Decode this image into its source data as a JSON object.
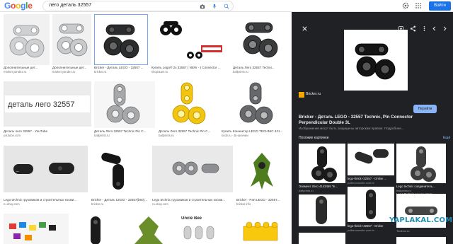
{
  "header": {
    "logo": "Google",
    "query": "лего деталь 32557",
    "signin": "Войти"
  },
  "results": [
    {
      "caption": "Дополнительные дет...",
      "source": "market.yandex.ru"
    },
    {
      "caption": "Дополнительные дет...",
      "source": "market.yandex.ru"
    },
    {
      "caption": "Bricker - Деталь LEGO - 32557 ...",
      "source": "bricker.ru"
    },
    {
      "caption": "Купить Lego® 2x 32557 ( NEW - ) Connector ...",
      "source": "shopotam.ru"
    },
    {
      "caption": "Деталь Лего 32557 Techni...",
      "source": "ballprints.ru"
    },
    {
      "caption": "Деталь лего 32557 - YouTube",
      "source": "youtube.com"
    },
    {
      "caption": "Деталь Лего 32557 Technic Pin C...",
      "source": "ballprints.ru"
    },
    {
      "caption": "Деталь Лего 32557 Technic Pin C...",
      "source": "ballprints.ru"
    },
    {
      "caption": "Купить Коннектор LEGO TECHNIC 421...",
      "source": "svob.ru · В наличии"
    },
    {
      "caption": "Lego technic грузовиков и строительных косми...",
      "source": "ru.ebay.com"
    },
    {
      "caption": "Bricker - Деталь LEGO - 32557(b60)...",
      "source": "bricker.ru"
    },
    {
      "caption": "Lego technic грузовиков и строительных косми...",
      "source": "ru.ebay.com"
    },
    {
      "caption": "Bricker - Part LEGO - 32557...",
      "source": "bricker.info"
    },
    {
      "caption": "",
      "source": ""
    },
    {
      "caption": "",
      "source": ""
    },
    {
      "caption": "",
      "source": ""
    },
    {
      "caption": "Uncle Bee",
      "source": ""
    },
    {
      "caption": "",
      "source": ""
    }
  ],
  "panel": {
    "source_site": "Bricker.ru",
    "visit_label": "Перейти",
    "title_line1": "Bricker - Деталь LEGO - 32557 Technic, Pin Connector",
    "title_line2": "Perpendicular Double 3L",
    "note": "Изображения могут быть защищены авторским правом.  Подробнее...",
    "related_label": "Похожие картинки",
    "all_label": "Ещё",
    "related": [
      {
        "caption": "",
        "source": ""
      },
      {
        "caption": "lego+brick+32557 - Online ...",
        "source": "politeconsulte.com.br"
      },
      {
        "caption": "Lego technic соединитель...",
        "source": "ballprints.ru"
      },
      {
        "caption": "Элемент Лего 4143466 Te...",
        "source": "ballprints.ru"
      },
      {
        "caption": "",
        "source": ""
      },
      {
        "caption": "Lego Technic соединитель...",
        "source": "Toolbox.ru"
      },
      {
        "caption": "lego+brick+32557 - Online",
        "source": "politeconsulte.com.br"
      },
      {
        "caption": "",
        "source": ""
      },
      {
        "caption": "",
        "source": ""
      }
    ]
  },
  "overlay": {
    "watermark": "YAPLAKAL.COM"
  },
  "colors": {
    "accent": "#1a73e8",
    "panel_bg": "#202124",
    "link_dark": "#8ab4f8"
  }
}
